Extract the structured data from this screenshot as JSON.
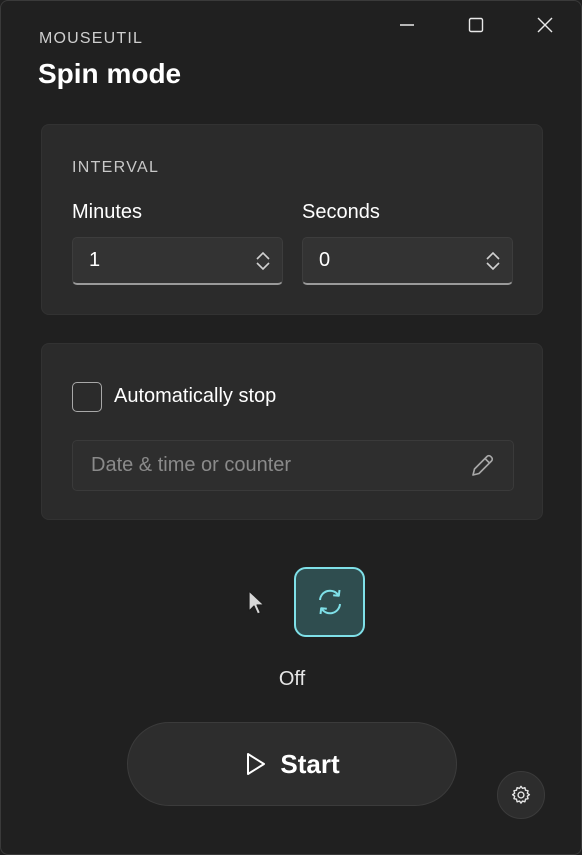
{
  "app": {
    "name": "MOUSEUTIL",
    "page_title": "Spin mode"
  },
  "window_controls": {
    "minimize": "minimize-icon",
    "maximize": "maximize-icon",
    "close": "close-icon"
  },
  "interval": {
    "label": "INTERVAL",
    "minutes": {
      "label": "Minutes",
      "value": "1"
    },
    "seconds": {
      "label": "Seconds",
      "value": "0"
    }
  },
  "auto_stop": {
    "checkbox_label": "Automatically stop",
    "checked": false,
    "placeholder": "Date & time or counter"
  },
  "spin_toggle": {
    "icon": "sync-icon",
    "status": "Off"
  },
  "start_button": {
    "label": "Start",
    "icon": "play-icon"
  },
  "settings_button": {
    "icon": "gear-icon"
  },
  "colors": {
    "background": "#202020",
    "card": "#2b2b2b",
    "accent": "#7fe0e8",
    "accent_fill": "#2f4d4f"
  }
}
